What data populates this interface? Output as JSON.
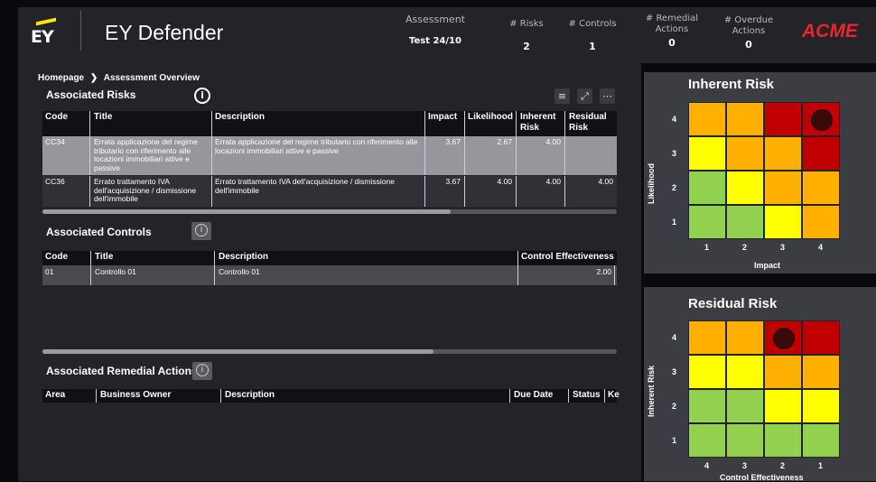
{
  "app": {
    "logo_text": "EY",
    "title": "EY Defender",
    "brand": "ACME"
  },
  "header_stats": [
    {
      "label": "Assessment",
      "value": "Test 24/10"
    },
    {
      "label": "# Risks",
      "value": "2"
    },
    {
      "label": "# Controls",
      "value": "1"
    },
    {
      "label": "# Remedial Actions",
      "value": "0"
    },
    {
      "label": "# Overdue Actions",
      "value": "0"
    }
  ],
  "breadcrumb": {
    "home": "Homepage",
    "separator": "❯",
    "current": "Assessment Overview"
  },
  "risks": {
    "title": "Associated Risks",
    "columns": [
      "Code",
      "Title",
      "Description",
      "Impact",
      "Likelihood",
      "Inherent Risk",
      "Residual Risk"
    ],
    "rows": [
      {
        "code": "CC34",
        "title": "Errata applicazione del regime tributario con riferimento alle locazioni immobiliari attive e passive",
        "description": "Errata applicazione del regime tributario con riferimento alle locazioni immobiliari attive e passive",
        "impact": "3.67",
        "likelihood": "2.67",
        "inherent": "4.00",
        "residual": ""
      },
      {
        "code": "CC36",
        "title": "Errato trattamento IVA dell'acquisizione / dismissione dell'immobile",
        "description": "Errato trattamento IVA dell'acquisizione / dismissione dell'immobile",
        "impact": "3.67",
        "likelihood": "4.00",
        "inherent": "4.00",
        "residual": "4.00"
      }
    ]
  },
  "controls": {
    "title": "Associated Controls",
    "columns": [
      "Code",
      "Title",
      "Description",
      "Control Effectiveness"
    ],
    "rows": [
      {
        "code": "01",
        "title": "Controllo 01",
        "description": "Controllo 01",
        "effectiveness": "2.00"
      }
    ]
  },
  "remedial": {
    "title": "Associated Remedial Actions",
    "columns": [
      "Area",
      "Business Owner",
      "Description",
      "Due Date",
      "Status",
      "Ke"
    ]
  },
  "inherent_heatmap": {
    "title": "Inherent Risk",
    "ylabel": "Likelihood",
    "xlabel": "Impact",
    "x_ticks": [
      "1",
      "2",
      "3",
      "4"
    ],
    "y_ticks": [
      "4",
      "3",
      "2",
      "1"
    ],
    "marker": {
      "x": "4",
      "y": "4"
    }
  },
  "residual_heatmap": {
    "title": "Residual Risk",
    "ylabel": "Inherent Risk",
    "xlabel": "Control Effectiveness",
    "x_ticks": [
      "4",
      "3",
      "2",
      "1"
    ],
    "y_ticks": [
      "4",
      "3",
      "2",
      "1"
    ],
    "marker": {
      "x": "2",
      "y": "4"
    }
  },
  "colors": {
    "red": "#c00000",
    "orange": "#ffb000",
    "yellow": "#ffff00",
    "green": "#92d050",
    "accent": "#ffe600",
    "brand": "#e8262b"
  }
}
